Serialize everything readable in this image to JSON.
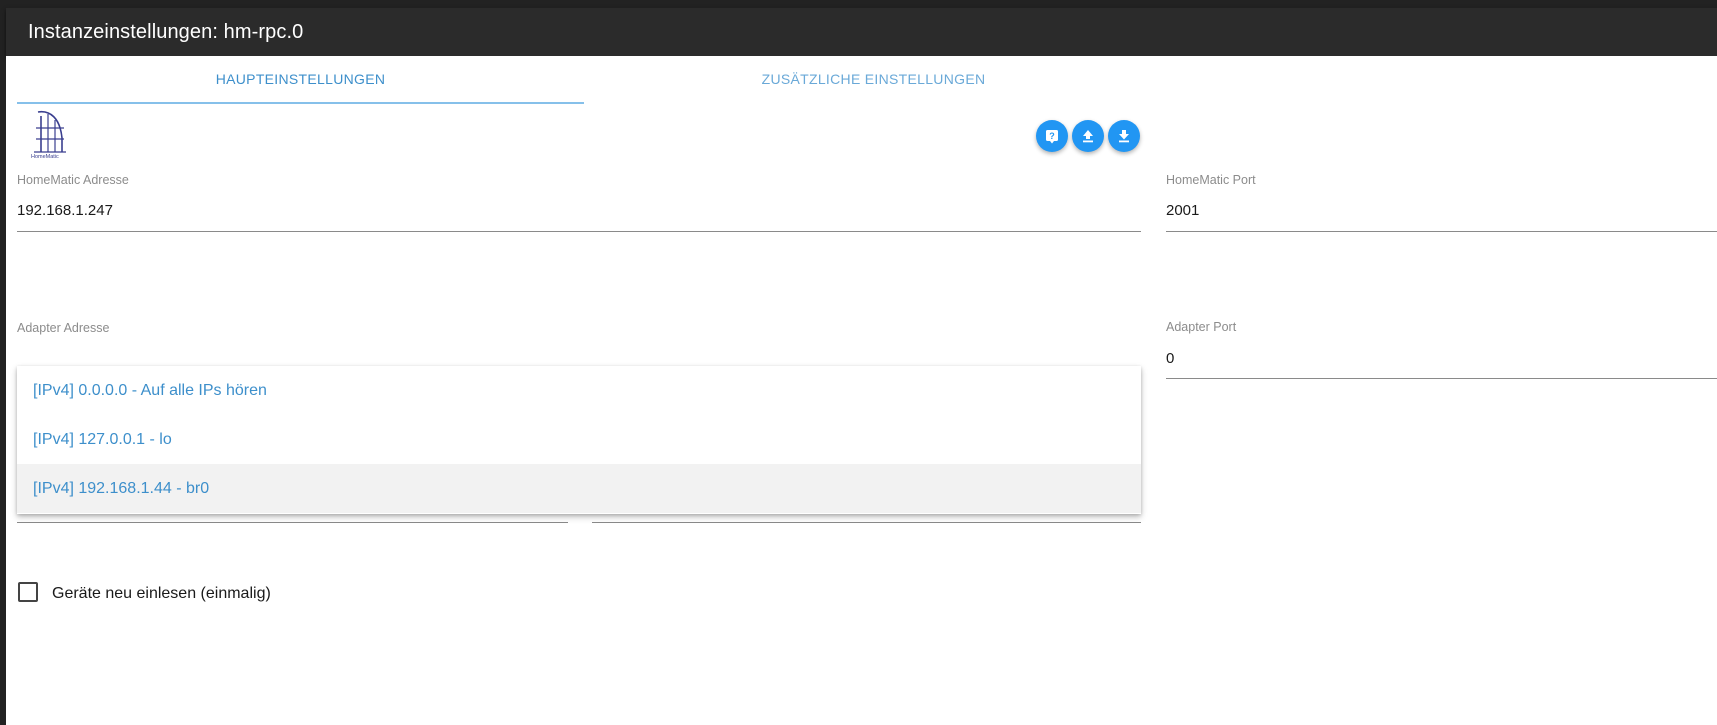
{
  "window": {
    "title": "Instanzeinstellungen: hm-rpc.0"
  },
  "tabs": [
    {
      "label": "HAUPTEINSTELLUNGEN",
      "active": true
    },
    {
      "label": "ZUSÄTZLICHE EINSTELLUNGEN",
      "active": false
    }
  ],
  "logo": {
    "text": "HomeMatic",
    "icon": "homematic-logo"
  },
  "actions": [
    {
      "icon": "help-icon"
    },
    {
      "icon": "upload-icon"
    },
    {
      "icon": "download-icon"
    }
  ],
  "fields": {
    "homematic_address": {
      "label": "HomeMatic Adresse",
      "value": "192.168.1.247"
    },
    "homematic_port": {
      "label": "HomeMatic Port",
      "value": "2001"
    },
    "adapter_address": {
      "label": "Adapter Adresse"
    },
    "adapter_port": {
      "label": "Adapter Port",
      "value": "0"
    }
  },
  "adapter_address_options": [
    "[IPv4] 0.0.0.0 - Auf alle IPs hören",
    "[IPv4] 127.0.0.1 - lo",
    "[IPv4] 192.168.1.44 - br0"
  ],
  "checkbox": {
    "label": "Geräte neu einlesen (einmalig)",
    "checked": false
  },
  "colors": {
    "accent": "#2196f3",
    "tab_text": "#3d8fcb",
    "titlebar": "#2b2b2b"
  }
}
